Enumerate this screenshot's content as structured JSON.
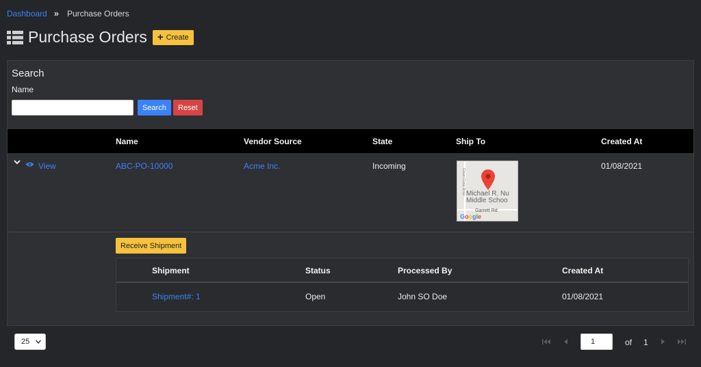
{
  "breadcrumb": {
    "home": "Dashboard",
    "separator": "»",
    "current": "Purchase Orders"
  },
  "header": {
    "title": "Purchase Orders",
    "create_label": "Create",
    "create_icon": "plus-icon",
    "title_icon": "list-icon"
  },
  "search": {
    "heading": "Search",
    "name_label": "Name",
    "name_value": "",
    "search_label": "Search",
    "reset_label": "Reset"
  },
  "table": {
    "columns": [
      "Name",
      "Vendor Source",
      "State",
      "Ship To",
      "Created At"
    ],
    "rows": [
      {
        "view_label": "View",
        "name": "ABC-PO-10000",
        "vendor": "Acme Inc.",
        "state": "Incoming",
        "ship_to": {
          "map_street1": "Green Cone Drive",
          "map_school_line1": "Michael R. Nu",
          "map_school_line2": "Middle Schoo",
          "map_street2": "Garrett Rd",
          "map_brand": "Google"
        },
        "created_at": "01/08/2021"
      }
    ]
  },
  "expanded": {
    "receive_label": "Receive Shipment",
    "columns": [
      "Shipment",
      "Status",
      "Processed By",
      "Created At"
    ],
    "rows": [
      {
        "shipment": "Shipment#:  1",
        "status": "Open",
        "processed_by": "John SO Doe",
        "created_at": "01/08/2021"
      }
    ]
  },
  "pagination": {
    "per_page": "25",
    "current_page": "1",
    "of_label": "of",
    "total_pages": "1"
  },
  "colors": {
    "background": "#25262a",
    "panel": "#2f3034",
    "accent_link": "#3b82f6",
    "warning_button": "#f6c23e",
    "danger_button": "#d64545",
    "map_pin": "#ea4335"
  }
}
